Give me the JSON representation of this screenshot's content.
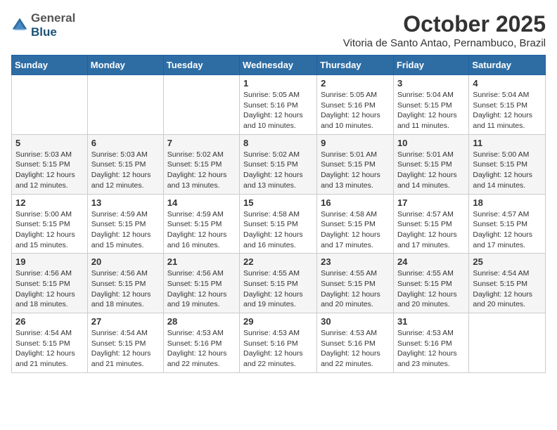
{
  "logo": {
    "general": "General",
    "blue": "Blue"
  },
  "header": {
    "month": "October 2025",
    "location": "Vitoria de Santo Antao, Pernambuco, Brazil"
  },
  "days_of_week": [
    "Sunday",
    "Monday",
    "Tuesday",
    "Wednesday",
    "Thursday",
    "Friday",
    "Saturday"
  ],
  "weeks": [
    [
      {
        "day": "",
        "info": ""
      },
      {
        "day": "",
        "info": ""
      },
      {
        "day": "",
        "info": ""
      },
      {
        "day": "1",
        "info": "Sunrise: 5:05 AM\nSunset: 5:16 PM\nDaylight: 12 hours\nand 10 minutes."
      },
      {
        "day": "2",
        "info": "Sunrise: 5:05 AM\nSunset: 5:16 PM\nDaylight: 12 hours\nand 10 minutes."
      },
      {
        "day": "3",
        "info": "Sunrise: 5:04 AM\nSunset: 5:15 PM\nDaylight: 12 hours\nand 11 minutes."
      },
      {
        "day": "4",
        "info": "Sunrise: 5:04 AM\nSunset: 5:15 PM\nDaylight: 12 hours\nand 11 minutes."
      }
    ],
    [
      {
        "day": "5",
        "info": "Sunrise: 5:03 AM\nSunset: 5:15 PM\nDaylight: 12 hours\nand 12 minutes."
      },
      {
        "day": "6",
        "info": "Sunrise: 5:03 AM\nSunset: 5:15 PM\nDaylight: 12 hours\nand 12 minutes."
      },
      {
        "day": "7",
        "info": "Sunrise: 5:02 AM\nSunset: 5:15 PM\nDaylight: 12 hours\nand 13 minutes."
      },
      {
        "day": "8",
        "info": "Sunrise: 5:02 AM\nSunset: 5:15 PM\nDaylight: 12 hours\nand 13 minutes."
      },
      {
        "day": "9",
        "info": "Sunrise: 5:01 AM\nSunset: 5:15 PM\nDaylight: 12 hours\nand 13 minutes."
      },
      {
        "day": "10",
        "info": "Sunrise: 5:01 AM\nSunset: 5:15 PM\nDaylight: 12 hours\nand 14 minutes."
      },
      {
        "day": "11",
        "info": "Sunrise: 5:00 AM\nSunset: 5:15 PM\nDaylight: 12 hours\nand 14 minutes."
      }
    ],
    [
      {
        "day": "12",
        "info": "Sunrise: 5:00 AM\nSunset: 5:15 PM\nDaylight: 12 hours\nand 15 minutes."
      },
      {
        "day": "13",
        "info": "Sunrise: 4:59 AM\nSunset: 5:15 PM\nDaylight: 12 hours\nand 15 minutes."
      },
      {
        "day": "14",
        "info": "Sunrise: 4:59 AM\nSunset: 5:15 PM\nDaylight: 12 hours\nand 16 minutes."
      },
      {
        "day": "15",
        "info": "Sunrise: 4:58 AM\nSunset: 5:15 PM\nDaylight: 12 hours\nand 16 minutes."
      },
      {
        "day": "16",
        "info": "Sunrise: 4:58 AM\nSunset: 5:15 PM\nDaylight: 12 hours\nand 17 minutes."
      },
      {
        "day": "17",
        "info": "Sunrise: 4:57 AM\nSunset: 5:15 PM\nDaylight: 12 hours\nand 17 minutes."
      },
      {
        "day": "18",
        "info": "Sunrise: 4:57 AM\nSunset: 5:15 PM\nDaylight: 12 hours\nand 17 minutes."
      }
    ],
    [
      {
        "day": "19",
        "info": "Sunrise: 4:56 AM\nSunset: 5:15 PM\nDaylight: 12 hours\nand 18 minutes."
      },
      {
        "day": "20",
        "info": "Sunrise: 4:56 AM\nSunset: 5:15 PM\nDaylight: 12 hours\nand 18 minutes."
      },
      {
        "day": "21",
        "info": "Sunrise: 4:56 AM\nSunset: 5:15 PM\nDaylight: 12 hours\nand 19 minutes."
      },
      {
        "day": "22",
        "info": "Sunrise: 4:55 AM\nSunset: 5:15 PM\nDaylight: 12 hours\nand 19 minutes."
      },
      {
        "day": "23",
        "info": "Sunrise: 4:55 AM\nSunset: 5:15 PM\nDaylight: 12 hours\nand 20 minutes."
      },
      {
        "day": "24",
        "info": "Sunrise: 4:55 AM\nSunset: 5:15 PM\nDaylight: 12 hours\nand 20 minutes."
      },
      {
        "day": "25",
        "info": "Sunrise: 4:54 AM\nSunset: 5:15 PM\nDaylight: 12 hours\nand 20 minutes."
      }
    ],
    [
      {
        "day": "26",
        "info": "Sunrise: 4:54 AM\nSunset: 5:15 PM\nDaylight: 12 hours\nand 21 minutes."
      },
      {
        "day": "27",
        "info": "Sunrise: 4:54 AM\nSunset: 5:15 PM\nDaylight: 12 hours\nand 21 minutes."
      },
      {
        "day": "28",
        "info": "Sunrise: 4:53 AM\nSunset: 5:16 PM\nDaylight: 12 hours\nand 22 minutes."
      },
      {
        "day": "29",
        "info": "Sunrise: 4:53 AM\nSunset: 5:16 PM\nDaylight: 12 hours\nand 22 minutes."
      },
      {
        "day": "30",
        "info": "Sunrise: 4:53 AM\nSunset: 5:16 PM\nDaylight: 12 hours\nand 22 minutes."
      },
      {
        "day": "31",
        "info": "Sunrise: 4:53 AM\nSunset: 5:16 PM\nDaylight: 12 hours\nand 23 minutes."
      },
      {
        "day": "",
        "info": ""
      }
    ]
  ]
}
